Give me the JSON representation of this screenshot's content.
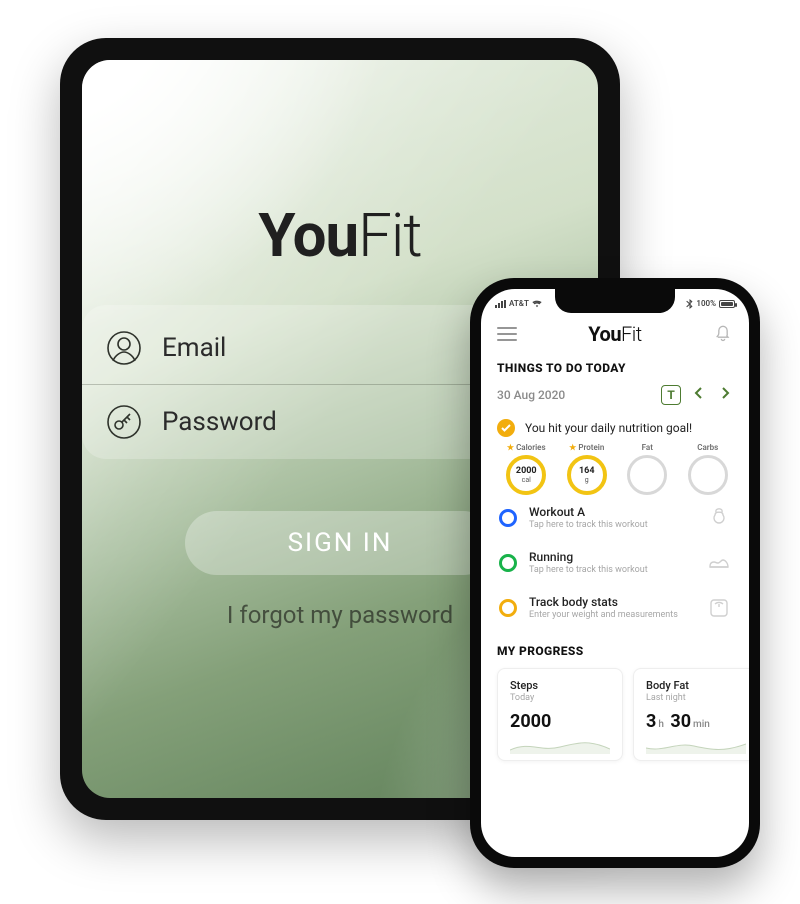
{
  "ipad": {
    "brand_bold": "You",
    "brand_thin": "Fit",
    "email_placeholder": "Email",
    "password_placeholder": "Password",
    "signin_label": "SIGN IN",
    "forgot_label": "I forgot my password"
  },
  "phone": {
    "status": {
      "carrier": "AT&T",
      "battery_text": "100%"
    },
    "brand_bold": "You",
    "brand_thin": "Fit",
    "things_title": "THINGS TO DO TODAY",
    "date": "30 Aug 2020",
    "today_button": "T",
    "goal_text": "You hit your daily nutrition goal!",
    "nutrition": {
      "calories": {
        "label": "Calories",
        "value": "2000",
        "unit": "cal"
      },
      "protein": {
        "label": "Protein",
        "value": "164",
        "unit": "g"
      },
      "fat": {
        "label": "Fat"
      },
      "carbs": {
        "label": "Carbs"
      }
    },
    "tasks": [
      {
        "color": "blue",
        "title": "Workout A",
        "sub": "Tap here to track this workout"
      },
      {
        "color": "green",
        "title": "Running",
        "sub": "Tap here to track this workout"
      },
      {
        "color": "orange",
        "title": "Track body stats",
        "sub": "Enter your weight and measurements"
      }
    ],
    "progress_title": "MY PROGRESS",
    "progress": [
      {
        "title": "Steps",
        "sub": "Today",
        "value_html": "2000"
      },
      {
        "title": "Body Fat",
        "sub": "Last night",
        "value_html": "3<small>h</small> 30<small>min</small>"
      }
    ]
  }
}
